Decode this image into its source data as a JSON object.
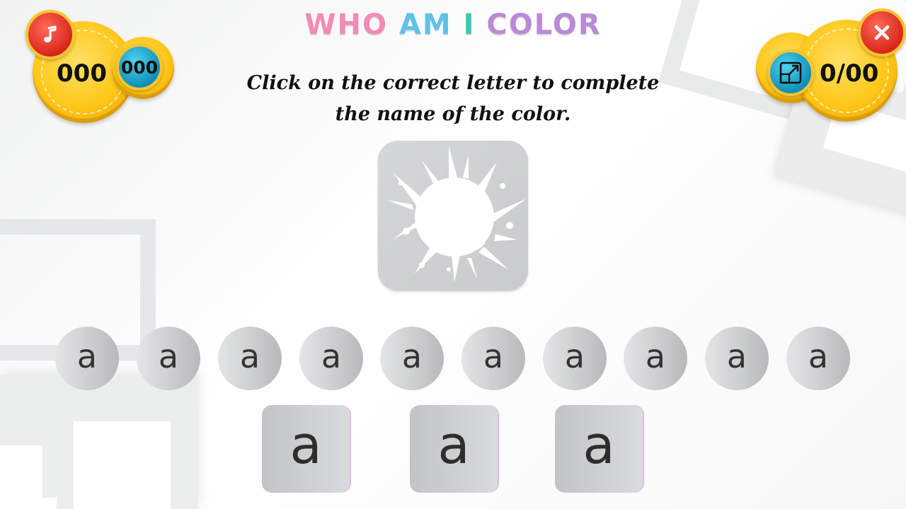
{
  "title": {
    "words": [
      {
        "text": "WHO",
        "color": "#f28bb5"
      },
      {
        "text": "AM",
        "color": "#5ec2ea"
      },
      {
        "text": "I",
        "color": "#3bc8b0"
      },
      {
        "text": "COLOR",
        "color": "#b98ad6"
      }
    ],
    "o_color": "#f8c33c"
  },
  "instruction": "Click on the correct letter to complete the name of the color.",
  "hud_left": {
    "score": "000",
    "bonus": "000",
    "music_icon": "music-note-icon"
  },
  "hud_right": {
    "progress": "0/00",
    "fullscreen_icon": "fullscreen-icon",
    "close_icon": "close-icon"
  },
  "color_card": {
    "icon": "paint-splash-icon",
    "card_color": "#d0d1d2",
    "splash_color": "#ffffff"
  },
  "letter_choices": [
    "a",
    "a",
    "a",
    "a",
    "a",
    "a",
    "a",
    "a",
    "a",
    "a"
  ],
  "answer_slots": [
    "a",
    "a",
    "a"
  ]
}
